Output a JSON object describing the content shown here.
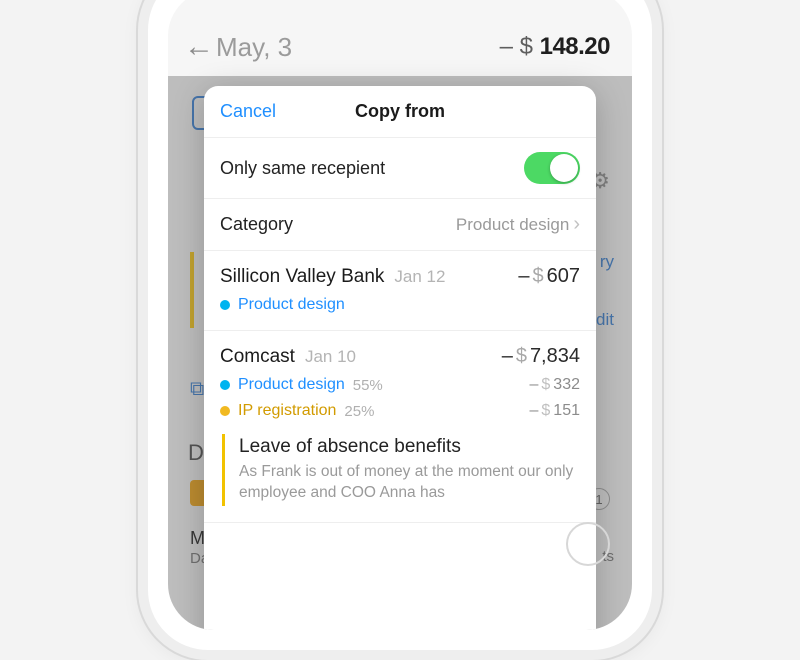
{
  "background": {
    "back_icon": "←",
    "date": "May, 3",
    "amount_prefix": "– $ ",
    "amount_value": "148.20",
    "gear_icon": "⚙",
    "link_glyph": "⧉",
    "peek_ry": "ry",
    "peek_dit": "dit",
    "section_d": "Di",
    "row_m": "M",
    "row_da": "Da",
    "badge": "1",
    "row_ts": "ts"
  },
  "modal": {
    "cancel": "Cancel",
    "title": "Copy from",
    "only_same_label": "Only same recepient",
    "only_same_on": true,
    "category_label": "Category",
    "category_value": "Product design"
  },
  "transactions": [
    {
      "vendor": "Sillicon Valley Bank",
      "date": "Jan 12",
      "amount": "607",
      "tags": [
        {
          "color": "blue",
          "name": "Product design"
        }
      ]
    },
    {
      "vendor": "Comcast",
      "date": "Jan 10",
      "amount": "7,834",
      "tags": [
        {
          "color": "blue",
          "name": "Product design",
          "pct": "55%",
          "amount": "332"
        },
        {
          "color": "gold",
          "name": "IP registration",
          "pct": "25%",
          "amount": "151"
        }
      ],
      "note": {
        "title": "Leave of absence benefits",
        "body": "As Frank is out of money at the moment our only employee and COO Anna has"
      }
    }
  ]
}
